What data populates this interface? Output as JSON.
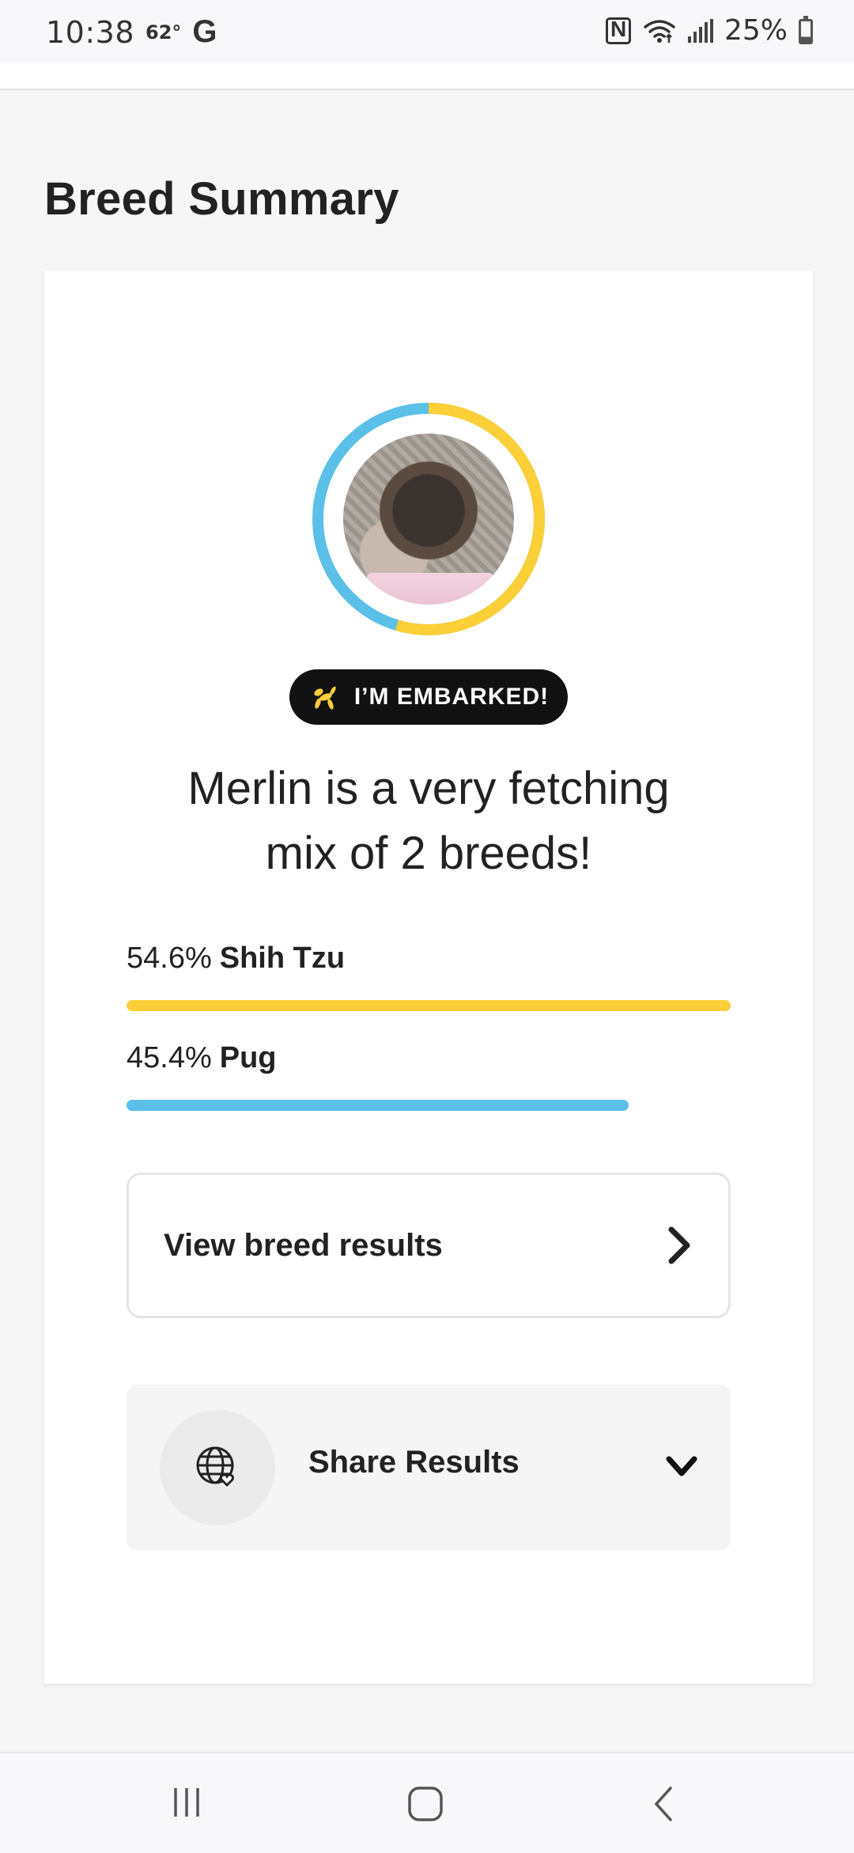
{
  "status_bar": {
    "time": "10:38",
    "temperature": "62°",
    "google_icon_label": "G",
    "battery": "25%",
    "icons": [
      "nfc-icon",
      "wifi-icon",
      "signal-icon",
      "battery-icon"
    ]
  },
  "page": {
    "title": "Breed Summary"
  },
  "summary": {
    "badge_label": "I’M EMBARKED!",
    "headline_line1": "Merlin is a very fetching",
    "headline_line2": "mix of 2 breeds!",
    "breeds": [
      {
        "percent": "54.6%",
        "name": "Shih Tzu",
        "fraction": 0.546,
        "color": "#FBCF38"
      },
      {
        "percent": "45.4%",
        "name": "Pug",
        "fraction": 0.454,
        "color": "#5BC0E8"
      }
    ],
    "view_results_label": "View breed results",
    "share_label": "Share Results"
  },
  "colors": {
    "yellow": "#FBCF38",
    "blue": "#5BC0E8",
    "badge_bg": "#111111"
  },
  "nav": {
    "items": [
      "recent-apps-icon",
      "home-icon",
      "back-icon"
    ]
  }
}
